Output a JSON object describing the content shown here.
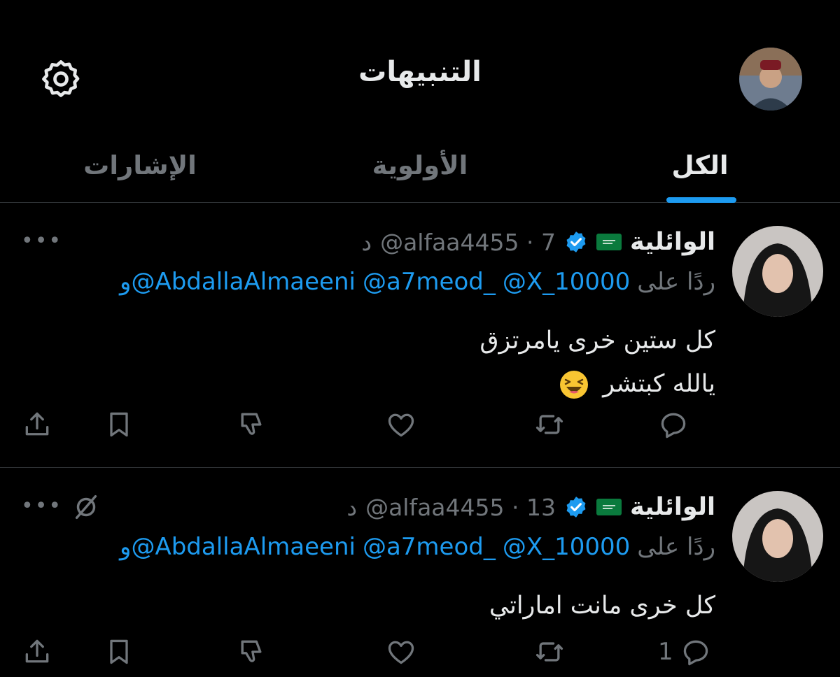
{
  "header": {
    "title": "التنبيهات",
    "settings_icon": "gear-icon",
    "avatar_icon": "user-avatar"
  },
  "tabs": [
    {
      "label": "الكل",
      "active": true
    },
    {
      "label": "الأولوية",
      "active": false
    },
    {
      "label": "الإشارات",
      "active": false
    }
  ],
  "colors": {
    "background": "#000000",
    "accent": "#1d9bf0",
    "muted": "#71767b",
    "text": "#e7e9ea",
    "divider": "#2f3336"
  },
  "tweets": [
    {
      "display_name": "الوائلية",
      "flag_icon": "saudi-flag-icon",
      "handle_time": "@alfaa4455 · 7",
      "time_unit": "د",
      "reply_prefix": "ردًا على",
      "mentions": [
        "@X_10000",
        "@a7meod_",
        "و@AbdallaAlmaeeni"
      ],
      "text_line_1": "كل ستين خرى يامرتزق",
      "text_line_2": "يالله كبتشر",
      "emoji_icon": "laughing-face-emoji",
      "reply_count": ""
    },
    {
      "display_name": "الوائلية",
      "flag_icon": "saudi-flag-icon",
      "handle_time": "@alfaa4455 · 13",
      "time_unit": "د",
      "reply_prefix": "ردًا على",
      "mentions": [
        "@X_10000",
        "@a7meod_",
        "و@AbdallaAlmaeeni"
      ],
      "text_line_1": "كل خرى مانت اماراتي",
      "reply_count": "1",
      "muted_icon": "mute-icon"
    }
  ]
}
